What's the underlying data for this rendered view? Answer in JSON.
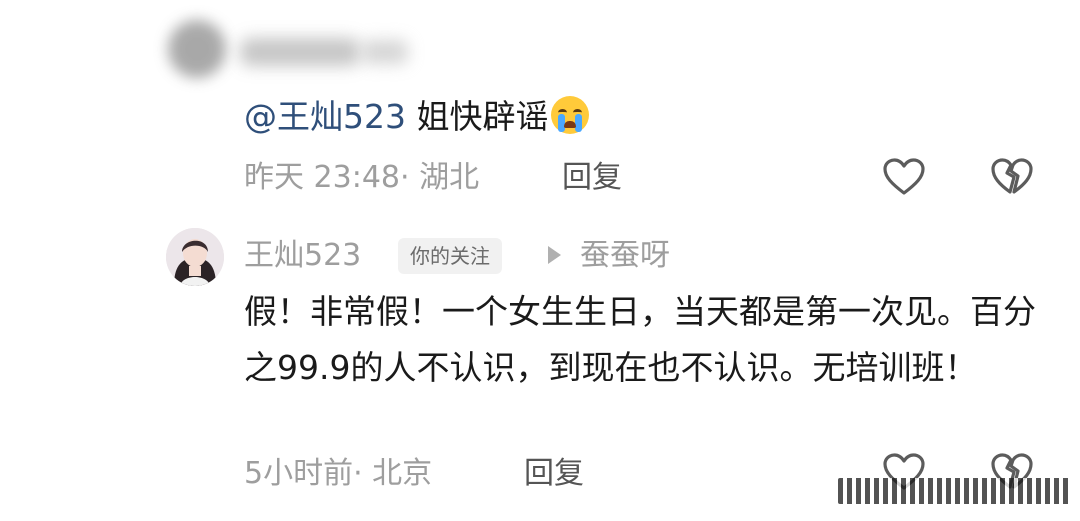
{
  "comment_parent": {
    "mention": "@王灿523",
    "text": " 姐快辟谣",
    "emoji": "crying-face-emoji",
    "time": "昨天 23:48",
    "location": "· 湖北",
    "reply_label": "回复"
  },
  "comment_reply": {
    "author": "王灿523",
    "badge": "你的关注",
    "reply_to": "蚕蚕呀",
    "body": "假！非常假！一个女生生日，当天都是第一次见。百分之99.9的人不认识，到现在也不认识。无培训班！",
    "time": "5小时前",
    "location": "· 北京",
    "reply_label": "回复"
  },
  "colors": {
    "mention": "#2f4f7a",
    "meta": "#9e9e9e",
    "body": "#1a1a1a"
  }
}
